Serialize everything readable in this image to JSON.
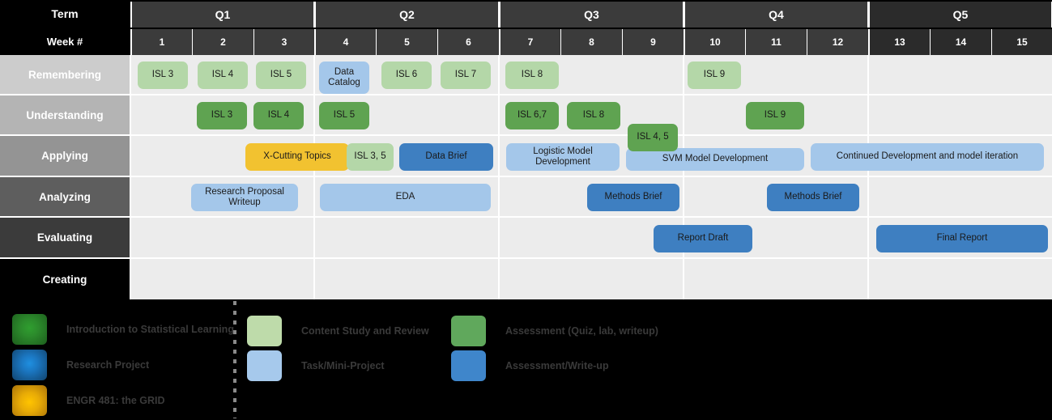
{
  "header": {
    "term_label": "Term",
    "week_label": "Week #",
    "quarters": [
      {
        "name": "Q1",
        "weeks": [
          "1",
          "2",
          "3"
        ]
      },
      {
        "name": "Q2",
        "weeks": [
          "4",
          "5",
          "6"
        ]
      },
      {
        "name": "Q3",
        "weeks": [
          "7",
          "8",
          "9"
        ]
      },
      {
        "name": "Q4",
        "weeks": [
          "10",
          "11",
          "12"
        ]
      },
      {
        "name": "Q5",
        "weeks": [
          "13",
          "14",
          "15"
        ]
      }
    ]
  },
  "rows": [
    {
      "label": "Remembering",
      "bg": "#cccccc"
    },
    {
      "label": "Understanding",
      "bg": "#b4b4b4"
    },
    {
      "label": "Applying",
      "bg": "#949494"
    },
    {
      "label": "Analyzing",
      "bg": "#5e5e5e"
    },
    {
      "label": "Evaluating",
      "bg": "#3b3b3b"
    },
    {
      "label": "Creating",
      "bg": "#000000"
    }
  ],
  "tasks": [
    {
      "label": "ISL 3",
      "row": "Remembering",
      "color": "#b4d7a8",
      "type": "content-study"
    },
    {
      "label": "ISL 4",
      "row": "Remembering",
      "color": "#b4d7a8",
      "type": "content-study"
    },
    {
      "label": "ISL 5",
      "row": "Remembering",
      "color": "#b4d7a8",
      "type": "content-study"
    },
    {
      "label": "Data Catalog",
      "row": "Remembering",
      "color": "#a4c7ea",
      "type": "task-mini-project"
    },
    {
      "label": "ISL 6",
      "row": "Remembering",
      "color": "#b4d7a8",
      "type": "content-study"
    },
    {
      "label": "ISL 7",
      "row": "Remembering",
      "color": "#b4d7a8",
      "type": "content-study"
    },
    {
      "label": "ISL 8",
      "row": "Remembering",
      "color": "#b4d7a8",
      "type": "content-study"
    },
    {
      "label": "ISL 9",
      "row": "Remembering",
      "color": "#b4d7a8",
      "type": "content-study"
    },
    {
      "label": "ISL 3",
      "row": "Understanding",
      "color": "#5fa351",
      "type": "assessment"
    },
    {
      "label": "ISL 4",
      "row": "Understanding",
      "color": "#5fa351",
      "type": "assessment"
    },
    {
      "label": "ISL 5",
      "row": "Understanding",
      "color": "#5fa351",
      "type": "assessment"
    },
    {
      "label": "ISL 6,7",
      "row": "Understanding",
      "color": "#5fa351",
      "type": "assessment"
    },
    {
      "label": "ISL 8",
      "row": "Understanding",
      "color": "#5fa351",
      "type": "assessment"
    },
    {
      "label": "ISL 4, 5",
      "row": "Understanding",
      "color": "#5fa351",
      "type": "assessment"
    },
    {
      "label": "ISL 9",
      "row": "Understanding",
      "color": "#5fa351",
      "type": "assessment"
    },
    {
      "label": "X-Cutting Topics",
      "row": "Applying",
      "color": "#f2c230",
      "type": "engr481"
    },
    {
      "label": "ISL 3, 5",
      "row": "Applying",
      "color": "#b4d7a8",
      "type": "content-study"
    },
    {
      "label": "Data Brief",
      "row": "Applying",
      "color": "#3e7fc1",
      "type": "assessment-writeup"
    },
    {
      "label": "Logistic Model Development",
      "row": "Applying",
      "color": "#a4c7ea",
      "type": "task-mini-project"
    },
    {
      "label": "SVM Model Development",
      "row": "Applying",
      "color": "#a4c7ea",
      "type": "task-mini-project"
    },
    {
      "label": "Continued Development and model iteration",
      "row": "Applying",
      "color": "#a4c7ea",
      "type": "task-mini-project"
    },
    {
      "label": "Research Proposal Writeup",
      "row": "Analyzing",
      "color": "#a4c7ea",
      "type": "task-mini-project"
    },
    {
      "label": "EDA",
      "row": "Analyzing",
      "color": "#a4c7ea",
      "type": "task-mini-project"
    },
    {
      "label": "Methods Brief",
      "row": "Analyzing",
      "color": "#3e7fc1",
      "type": "assessment-writeup"
    },
    {
      "label": "Methods Brief",
      "row": "Analyzing",
      "color": "#3e7fc1",
      "type": "assessment-writeup"
    },
    {
      "label": "Report Draft",
      "row": "Evaluating",
      "color": "#3e7fc1",
      "type": "assessment-writeup"
    },
    {
      "label": "Final Report",
      "row": "Evaluating",
      "color": "#3e7fc1",
      "type": "assessment-writeup"
    }
  ],
  "legend": {
    "columns": [
      {
        "items": [
          {
            "label": "Introduction to Statistical Learning",
            "swatch": "grad-green",
            "color": "#2c8b2c"
          },
          {
            "label": "Research Project",
            "swatch": "grad-blue",
            "color": "#1b76c0"
          },
          {
            "label": "ENGR 481: the GRID",
            "swatch": "grad-yellow",
            "color": "#e8ab06"
          }
        ]
      },
      {
        "items": [
          {
            "label": "Content Study and Review",
            "swatch": "flat-lightgreen",
            "color": "#bedbaa"
          },
          {
            "label": "Task/Mini-Project",
            "swatch": "flat-lightblue",
            "color": "#a6c9ec"
          }
        ]
      },
      {
        "items": [
          {
            "label": "Assessment (Quiz, lab, writeup)",
            "swatch": "flat-green",
            "color": "#60a85c"
          },
          {
            "label": "Assessment/Write-up",
            "swatch": "flat-blue",
            "color": "#3f86cb"
          }
        ]
      }
    ]
  }
}
